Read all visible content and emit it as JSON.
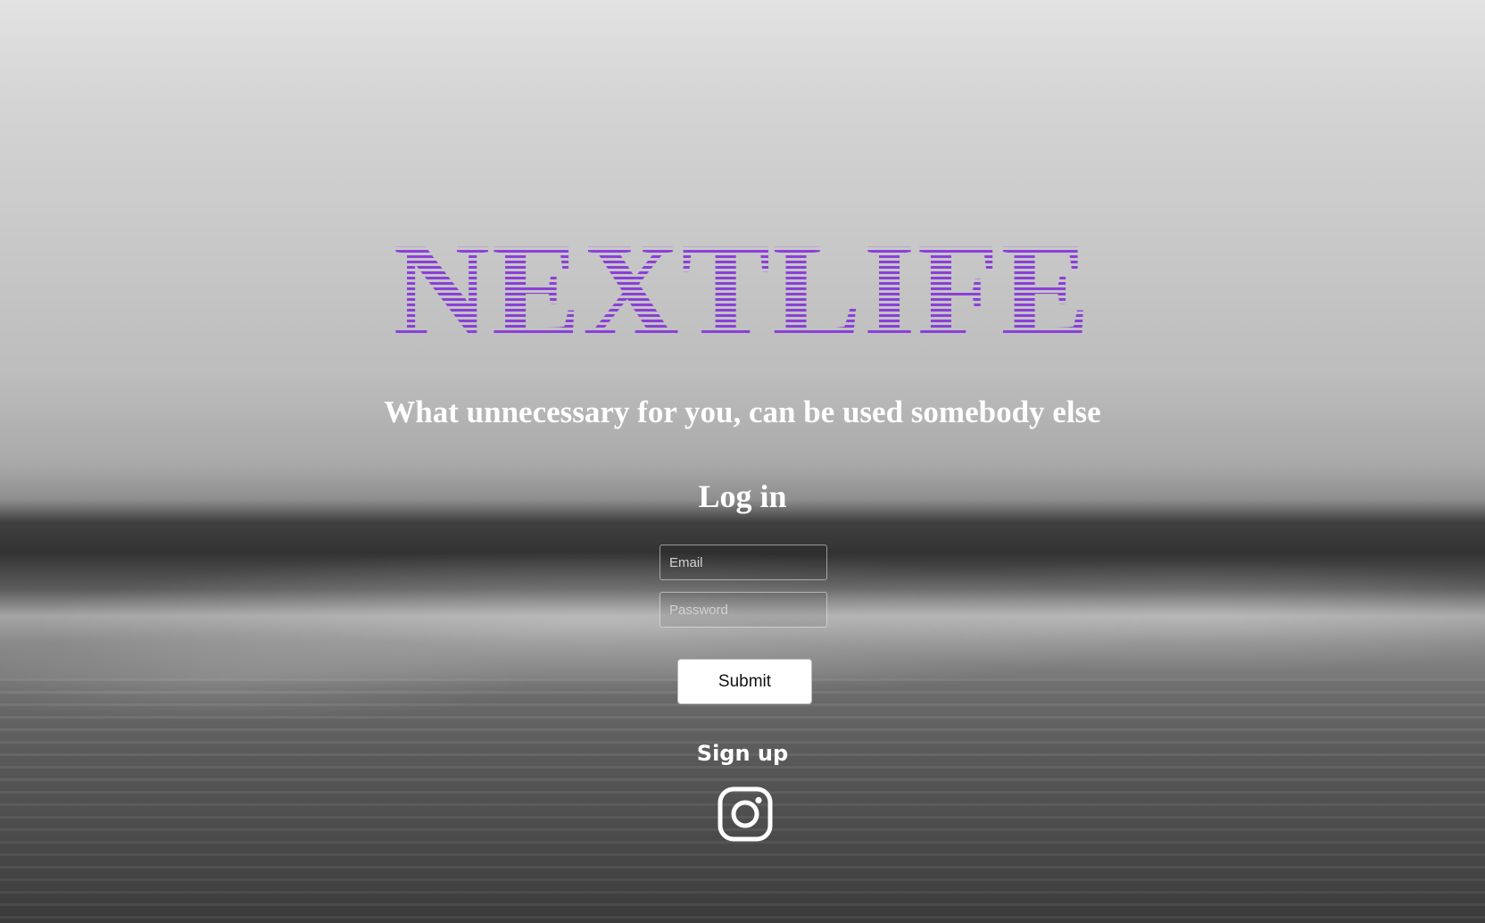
{
  "brand": {
    "title": "NEXTLIFE",
    "title_color": "#8b3fd9",
    "tagline": "What unnecessary for you, can be used somebody else"
  },
  "login": {
    "heading": "Log in",
    "email_placeholder": "Email",
    "password_placeholder": "Password",
    "submit_label": "Submit",
    "signup_label": "Sign up"
  },
  "social": {
    "icon": "instagram-icon"
  }
}
